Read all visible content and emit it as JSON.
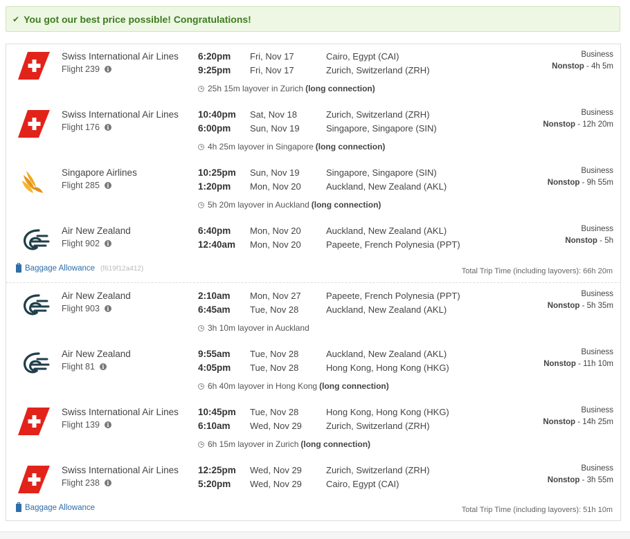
{
  "alert": {
    "text": "You got our best price possible! Congratulations!",
    "icon": "check-icon",
    "color": "#3c7d1e"
  },
  "segments": [
    {
      "airline": "Swiss International Air Lines",
      "logo": "swiss",
      "flight": "Flight 239",
      "dep_time": "6:20pm",
      "dep_date": "Fri, Nov 17",
      "dep_city": "Cairo, Egypt (CAI)",
      "arr_time": "9:25pm",
      "arr_date": "Fri, Nov 17",
      "arr_city": "Zurich, Switzerland (ZRH)",
      "cabin": "Business",
      "stops": "Nonstop",
      "duration": "- 4h 5m",
      "layover": "25h 15m layover in Zurich",
      "layover_note": "(long connection)"
    },
    {
      "airline": "Swiss International Air Lines",
      "logo": "swiss",
      "flight": "Flight 176",
      "dep_time": "10:40pm",
      "dep_date": "Sat, Nov 18",
      "dep_city": "Zurich, Switzerland (ZRH)",
      "arr_time": "6:00pm",
      "arr_date": "Sun, Nov 19",
      "arr_city": "Singapore, Singapore (SIN)",
      "cabin": "Business",
      "stops": "Nonstop",
      "duration": "- 12h 20m",
      "layover": "4h 25m layover in Singapore",
      "layover_note": "(long connection)"
    },
    {
      "airline": "Singapore Airlines",
      "logo": "singapore",
      "flight": "Flight 285",
      "dep_time": "10:25pm",
      "dep_date": "Sun, Nov 19",
      "dep_city": "Singapore, Singapore (SIN)",
      "arr_time": "1:20pm",
      "arr_date": "Mon, Nov 20",
      "arr_city": "Auckland, New Zealand (AKL)",
      "cabin": "Business",
      "stops": "Nonstop",
      "duration": "- 9h 55m",
      "layover": "5h 20m layover in Auckland",
      "layover_note": "(long connection)"
    },
    {
      "airline": "Air New Zealand",
      "logo": "airnz",
      "flight": "Flight 902",
      "dep_time": "6:40pm",
      "dep_date": "Mon, Nov 20",
      "dep_city": "Auckland, New Zealand (AKL)",
      "arr_time": "12:40am",
      "arr_date": "Mon, Nov 20",
      "arr_city": "Papeete, French Polynesia (PPT)",
      "cabin": "Business",
      "stops": "Nonstop",
      "duration": "- 5h",
      "layover": "",
      "layover_note": ""
    },
    {
      "airline": "Air New Zealand",
      "logo": "airnz",
      "flight": "Flight 903",
      "dep_time": "2:10am",
      "dep_date": "Mon, Nov 27",
      "dep_city": "Papeete, French Polynesia (PPT)",
      "arr_time": "6:45am",
      "arr_date": "Tue, Nov 28",
      "arr_city": "Auckland, New Zealand (AKL)",
      "cabin": "Business",
      "stops": "Nonstop",
      "duration": "- 5h 35m",
      "layover": "3h 10m layover in Auckland",
      "layover_note": ""
    },
    {
      "airline": "Air New Zealand",
      "logo": "airnz",
      "flight": "Flight 81",
      "dep_time": "9:55am",
      "dep_date": "Tue, Nov 28",
      "dep_city": "Auckland, New Zealand (AKL)",
      "arr_time": "4:05pm",
      "arr_date": "Tue, Nov 28",
      "arr_city": "Hong Kong, Hong Kong (HKG)",
      "cabin": "Business",
      "stops": "Nonstop",
      "duration": "- 11h 10m",
      "layover": "6h 40m layover in Hong Kong",
      "layover_note": "(long connection)"
    },
    {
      "airline": "Swiss International Air Lines",
      "logo": "swiss",
      "flight": "Flight 139",
      "dep_time": "10:45pm",
      "dep_date": "Tue, Nov 28",
      "dep_city": "Hong Kong, Hong Kong (HKG)",
      "arr_time": "6:10am",
      "arr_date": "Wed, Nov 29",
      "arr_city": "Zurich, Switzerland (ZRH)",
      "cabin": "Business",
      "stops": "Nonstop",
      "duration": "- 14h 25m",
      "layover": "6h 15m layover in Zurich",
      "layover_note": "(long connection)"
    },
    {
      "airline": "Swiss International Air Lines",
      "logo": "swiss",
      "flight": "Flight 238",
      "dep_time": "12:25pm",
      "dep_date": "Wed, Nov 29",
      "dep_city": "Zurich, Switzerland (ZRH)",
      "arr_time": "5:20pm",
      "arr_date": "Wed, Nov 29",
      "arr_city": "Cairo, Egypt (CAI)",
      "cabin": "Business",
      "stops": "Nonstop",
      "duration": "- 3h 55m",
      "layover": "",
      "layover_note": ""
    }
  ],
  "outbound_footer": {
    "baggage_label": "Baggage Allowance",
    "code": "(f619f12a412)",
    "total": "Total Trip Time (including layovers): 66h 20m"
  },
  "return_footer": {
    "baggage_label": "Baggage Allowance",
    "total": "Total Trip Time (including layovers): 51h 10m"
  },
  "colors": {
    "accent_link": "#2f6ea8",
    "swiss_red": "#e2231a",
    "singapore_gold": "#f1a81c",
    "airnz_teal": "#1f3f4a"
  }
}
